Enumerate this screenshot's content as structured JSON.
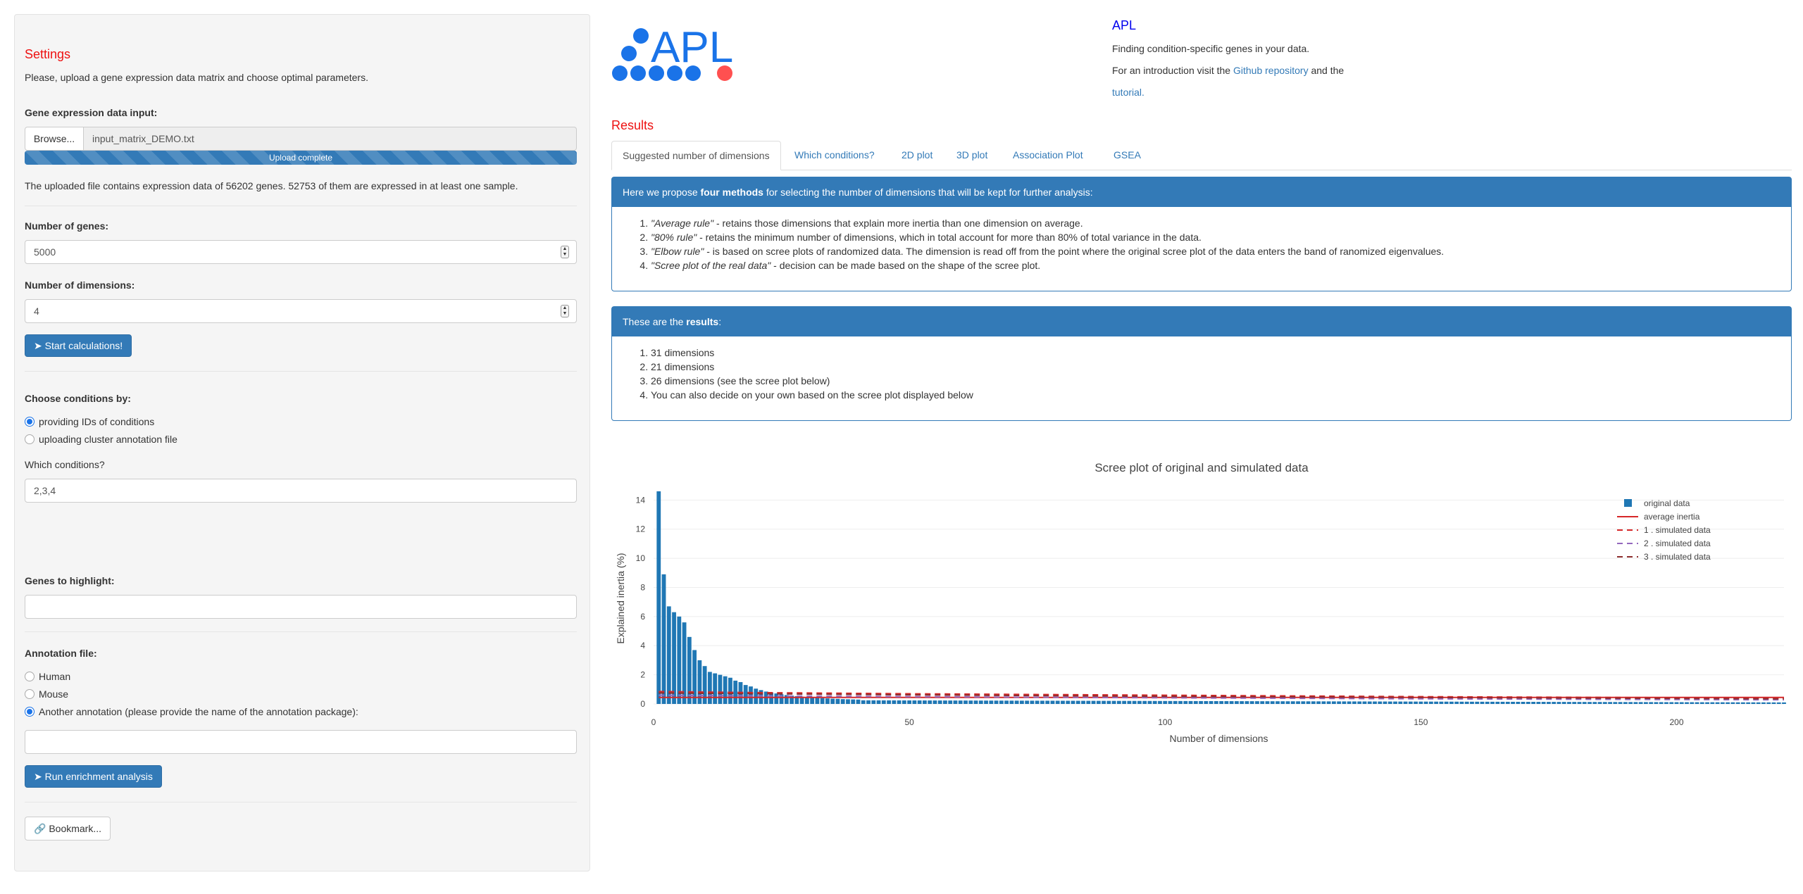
{
  "colors": {
    "accent": "#337ab7",
    "title_red": "#ee1111",
    "logo_blue": "#1a73e8",
    "logo_red": "#ff5050"
  },
  "sidebar": {
    "title": "Settings",
    "subtitle": "Please, upload a gene expression data matrix and choose optimal parameters.",
    "gene_input_label": "Gene expression data input:",
    "browse_label": "Browse...",
    "file_name": "input_matrix_DEMO.txt",
    "progress_label": "Upload complete",
    "progress_value": 1.0,
    "upload_info": "The uploaded file contains expression data of 56202 genes. 52753 of them are expressed in at least one sample.",
    "num_genes_label": "Number of genes:",
    "num_genes_value": "5000",
    "num_dims_label": "Number of dimensions:",
    "num_dims_value": "4",
    "start_button": "Start calculations!",
    "conditions_by_label": "Choose conditions by:",
    "conditions_options": [
      "providing IDs of conditions",
      "uploading cluster annotation file"
    ],
    "conditions_selected": 0,
    "which_conditions_label": "Which conditions?",
    "which_conditions_value": "2,3,4",
    "highlight_label": "Genes to highlight:",
    "highlight_value": "",
    "annotation_label": "Annotation file:",
    "annotation_options": [
      "Human",
      "Mouse",
      "Another annotation (please provide the name of the annotation package):"
    ],
    "annotation_selected": 2,
    "annotation_value": "",
    "enrichment_button": "Run enrichment analysis",
    "bookmark_button": "Bookmark...",
    "up_icon": "caret-up-icon",
    "down_icon": "caret-down-icon",
    "send_icon": "paper-plane-icon",
    "link_icon": "link-icon"
  },
  "header": {
    "logo_text": "APL",
    "app_name": "APL",
    "line1": "Finding condition-specific genes in your data.",
    "line2_prefix": "For an introduction visit the",
    "line2_link": "Github repository",
    "line2_suffix": "and the",
    "line3_link": "tutorial."
  },
  "results": {
    "title": "Results",
    "tabs": [
      "Suggested number of dimensions",
      "Which conditions?",
      "2D plot",
      "3D plot",
      "Association Plot",
      "GSEA"
    ],
    "active_tab": 0,
    "panel1": {
      "head_prefix": "Here we propose",
      "head_bold": "four methods",
      "head_suffix": "for selecting the number of dimensions that will be kept for further analysis:",
      "items": [
        {
          "em": "\"Average rule\"",
          "text": " - retains those dimensions that explain more inertia than one dimension on average."
        },
        {
          "em": "\"80% rule\"",
          "text": " - retains the minimum number of dimensions, which in total account for more than 80% of total variance in the data."
        },
        {
          "em": "\"Elbow rule\"",
          "text": " - is based on scree plots of randomized data. The dimension is read off from the point where the original scree plot of the data enters the band of ranomized eigenvalues."
        },
        {
          "em": "\"Scree plot of the real data\"",
          "text": " - decision can be made based on the shape of the scree plot."
        }
      ]
    },
    "panel2": {
      "head_prefix": "These are the",
      "head_bold": "results",
      "head_suffix": ":",
      "items": [
        "31 dimensions",
        "21 dimensions",
        "26 dimensions (see the scree plot below)",
        "You can also decide on your own based on the scree plot displayed below"
      ]
    }
  },
  "chart_data": {
    "type": "bar",
    "title": "Scree plot of original and simulated data",
    "xlabel": "Number of dimensions",
    "ylabel": "Explained inertia (%)",
    "xlim": [
      0,
      221
    ],
    "ylim": [
      0,
      14.5
    ],
    "xticks": [
      0,
      50,
      100,
      150,
      200
    ],
    "yticks": [
      0,
      2,
      4,
      6,
      8,
      10,
      12,
      14
    ],
    "grid": true,
    "legend_position": "top-right",
    "bar_values": [
      14.6,
      8.9,
      6.7,
      6.3,
      6.0,
      5.6,
      4.6,
      3.7,
      3.0,
      2.6,
      2.2,
      2.1,
      2.0,
      1.9,
      1.8,
      1.6,
      1.5,
      1.3,
      1.2,
      1.05,
      0.95,
      0.85,
      0.78,
      0.72,
      0.66,
      0.61,
      0.57,
      0.53,
      0.5,
      0.47,
      0.44,
      0.42,
      0.4,
      0.38,
      0.36,
      0.35,
      0.33,
      0.32,
      0.31,
      0.3
    ],
    "bar_tail_value": 0.25,
    "n_bars": 221,
    "series": [
      {
        "name": "original data",
        "style": "bar",
        "color": "#1f77b4"
      },
      {
        "name": "average inertia",
        "style": "solid",
        "color": "#d62728",
        "values": [
          0.45
        ]
      },
      {
        "name": "1 . simulated data",
        "style": "dashed",
        "color": "#d62728",
        "x": [
          1,
          20,
          50,
          100,
          150,
          221
        ],
        "values": [
          0.85,
          0.78,
          0.7,
          0.6,
          0.5,
          0.4
        ]
      },
      {
        "name": "2 . simulated data",
        "style": "dashed",
        "color": "#9467bd",
        "x": [
          1,
          20,
          50,
          100,
          150,
          221
        ],
        "values": [
          0.6,
          0.55,
          0.5,
          0.42,
          0.35,
          0.28
        ]
      },
      {
        "name": "3 . simulated data",
        "style": "dashed",
        "color": "#8c2d2d",
        "x": [
          1,
          20,
          50,
          100,
          150,
          221
        ],
        "values": [
          0.75,
          0.7,
          0.62,
          0.52,
          0.44,
          0.35
        ]
      }
    ]
  }
}
